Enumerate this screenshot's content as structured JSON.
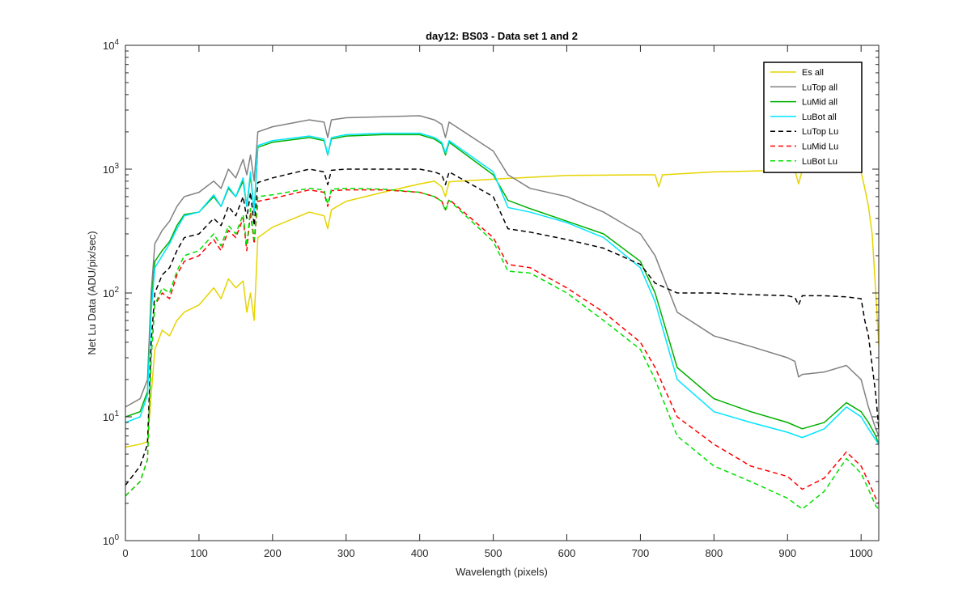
{
  "chart_data": {
    "type": "line",
    "title": "day12: BS03 - Data set 1 and 2",
    "xlabel": "Wavelength (pixels)",
    "ylabel": "Net Lu Data (ADU/pix/sec)",
    "xlim": [
      0,
      1024
    ],
    "ylim": [
      1,
      10000
    ],
    "yscale": "log",
    "x_ticks": [
      0,
      100,
      200,
      300,
      400,
      500,
      600,
      700,
      800,
      900,
      1000
    ],
    "x_tick_labels": [
      "0",
      "100",
      "200",
      "300",
      "400",
      "500",
      "600",
      "700",
      "800",
      "900",
      "1000"
    ],
    "y_ticks": [
      1,
      10,
      100,
      1000,
      10000
    ],
    "y_tick_labels": [
      {
        "base": "10",
        "exp": "0"
      },
      {
        "base": "10",
        "exp": "1"
      },
      {
        "base": "10",
        "exp": "2"
      },
      {
        "base": "10",
        "exp": "3"
      },
      {
        "base": "10",
        "exp": "4"
      }
    ],
    "grid": false,
    "legend_position": "top-right",
    "series": [
      {
        "name": "Es  all",
        "color": "#e6d400",
        "dash": "solid",
        "x": [
          0,
          20,
          30,
          35,
          40,
          50,
          60,
          70,
          80,
          100,
          120,
          130,
          140,
          150,
          160,
          165,
          170,
          175,
          180,
          200,
          250,
          270,
          275,
          280,
          300,
          350,
          400,
          420,
          430,
          435,
          440,
          500,
          600,
          700,
          720,
          725,
          730,
          800,
          900,
          910,
          915,
          920,
          980,
          1000,
          1005,
          1010,
          1015,
          1020,
          1024
        ],
        "y": [
          5.7,
          6,
          6.3,
          15,
          35,
          50,
          45,
          60,
          70,
          80,
          110,
          90,
          130,
          110,
          125,
          70,
          100,
          60,
          280,
          340,
          450,
          420,
          330,
          470,
          550,
          650,
          760,
          800,
          720,
          600,
          790,
          830,
          890,
          900,
          900,
          720,
          900,
          950,
          980,
          980,
          760,
          980,
          980,
          950,
          700,
          500,
          300,
          100,
          38
        ]
      },
      {
        "name": "LuTop  all",
        "color": "#808080",
        "dash": "solid",
        "x": [
          0,
          20,
          30,
          35,
          40,
          50,
          60,
          70,
          80,
          100,
          120,
          130,
          140,
          150,
          160,
          165,
          170,
          175,
          180,
          200,
          250,
          270,
          275,
          280,
          300,
          350,
          400,
          420,
          430,
          435,
          440,
          500,
          520,
          550,
          600,
          650,
          700,
          720,
          750,
          800,
          850,
          900,
          910,
          915,
          920,
          950,
          980,
          1000,
          1010,
          1020,
          1024
        ],
        "y": [
          12,
          14,
          20,
          100,
          250,
          320,
          380,
          500,
          600,
          650,
          800,
          700,
          1000,
          850,
          1200,
          900,
          1300,
          800,
          2000,
          2200,
          2500,
          2400,
          1800,
          2500,
          2600,
          2650,
          2700,
          2500,
          2300,
          1800,
          2400,
          1400,
          900,
          700,
          600,
          450,
          300,
          200,
          70,
          45,
          37,
          30,
          28,
          21,
          22,
          23,
          26,
          20,
          12,
          8,
          7
        ]
      },
      {
        "name": "LuMid  all",
        "color": "#00b000",
        "dash": "solid",
        "x": [
          0,
          20,
          30,
          35,
          40,
          50,
          60,
          70,
          80,
          100,
          120,
          130,
          140,
          150,
          160,
          165,
          170,
          175,
          180,
          200,
          250,
          270,
          275,
          280,
          300,
          350,
          400,
          420,
          430,
          435,
          440,
          500,
          520,
          550,
          600,
          650,
          700,
          720,
          750,
          800,
          850,
          900,
          920,
          950,
          980,
          1000,
          1010,
          1020,
          1024
        ],
        "y": [
          10,
          11,
          16,
          80,
          180,
          220,
          260,
          350,
          430,
          450,
          600,
          500,
          700,
          600,
          800,
          500,
          900,
          450,
          1500,
          1650,
          1800,
          1700,
          1300,
          1750,
          1850,
          1900,
          1900,
          1750,
          1600,
          1300,
          1650,
          900,
          560,
          480,
          380,
          300,
          180,
          100,
          25,
          14,
          11,
          9,
          8,
          9,
          13,
          11,
          9,
          7,
          6
        ]
      },
      {
        "name": "LuBot  all",
        "color": "#00e5ff",
        "dash": "solid",
        "x": [
          0,
          20,
          30,
          35,
          40,
          50,
          60,
          70,
          80,
          100,
          120,
          130,
          140,
          150,
          160,
          165,
          170,
          175,
          180,
          200,
          250,
          270,
          275,
          280,
          300,
          350,
          400,
          420,
          430,
          435,
          440,
          500,
          520,
          550,
          600,
          650,
          700,
          720,
          750,
          800,
          850,
          900,
          920,
          950,
          980,
          1000,
          1010,
          1020,
          1024
        ],
        "y": [
          9,
          10,
          15,
          70,
          160,
          200,
          250,
          330,
          420,
          450,
          620,
          500,
          720,
          600,
          850,
          500,
          950,
          450,
          1550,
          1700,
          1850,
          1750,
          1300,
          1800,
          1900,
          1950,
          1950,
          1800,
          1650,
          1350,
          1700,
          950,
          490,
          450,
          370,
          280,
          160,
          85,
          20,
          11,
          9,
          7.5,
          6.8,
          8,
          12,
          10,
          8,
          6.5,
          6
        ]
      },
      {
        "name": "LuTop  Lu",
        "color": "#000000",
        "dash": "dashed",
        "x": [
          0,
          20,
          30,
          35,
          40,
          50,
          60,
          70,
          80,
          100,
          120,
          130,
          140,
          150,
          160,
          165,
          170,
          175,
          180,
          200,
          250,
          270,
          275,
          280,
          300,
          350,
          400,
          420,
          430,
          435,
          440,
          500,
          520,
          550,
          600,
          650,
          700,
          720,
          750,
          800,
          850,
          900,
          910,
          915,
          920,
          950,
          980,
          1000,
          1005,
          1010,
          1020,
          1024
        ],
        "y": [
          2.8,
          4,
          6,
          40,
          100,
          140,
          160,
          220,
          280,
          300,
          400,
          350,
          500,
          420,
          600,
          400,
          650,
          350,
          780,
          850,
          1000,
          950,
          750,
          980,
          1000,
          1000,
          1000,
          950,
          900,
          750,
          950,
          600,
          330,
          310,
          270,
          230,
          170,
          120,
          100,
          100,
          97,
          95,
          92,
          80,
          95,
          95,
          93,
          90,
          60,
          45,
          15,
          8
        ]
      },
      {
        "name": "LuMid  Lu",
        "color": "#ff0000",
        "dash": "dashed",
        "x": [
          0,
          20,
          30,
          35,
          40,
          50,
          60,
          70,
          80,
          100,
          120,
          130,
          140,
          150,
          160,
          165,
          170,
          175,
          180,
          200,
          250,
          270,
          275,
          280,
          300,
          350,
          400,
          420,
          430,
          435,
          440,
          500,
          520,
          550,
          600,
          650,
          700,
          720,
          750,
          800,
          850,
          900,
          920,
          950,
          980,
          1000,
          1010,
          1020,
          1024
        ],
        "y": [
          2.3,
          3,
          4.5,
          30,
          80,
          100,
          90,
          140,
          180,
          200,
          270,
          220,
          320,
          280,
          400,
          220,
          450,
          250,
          550,
          580,
          680,
          650,
          500,
          670,
          680,
          680,
          650,
          600,
          550,
          470,
          570,
          280,
          170,
          160,
          110,
          70,
          40,
          25,
          10,
          6,
          4,
          3.3,
          2.6,
          3.2,
          5.2,
          4,
          3,
          2.2,
          2
        ]
      },
      {
        "name": "LuBot  Lu",
        "color": "#00e000",
        "dash": "dashed",
        "x": [
          0,
          20,
          30,
          35,
          40,
          50,
          60,
          70,
          80,
          100,
          120,
          130,
          140,
          150,
          160,
          165,
          170,
          175,
          180,
          200,
          250,
          270,
          275,
          280,
          300,
          350,
          400,
          420,
          430,
          435,
          440,
          500,
          520,
          550,
          600,
          650,
          700,
          720,
          750,
          800,
          850,
          900,
          920,
          950,
          980,
          1000,
          1010,
          1020,
          1024
        ],
        "y": [
          2.3,
          3,
          4.5,
          30,
          80,
          110,
          100,
          150,
          200,
          220,
          300,
          240,
          350,
          300,
          430,
          240,
          480,
          270,
          600,
          620,
          700,
          680,
          520,
          690,
          700,
          690,
          650,
          600,
          550,
          460,
          560,
          260,
          150,
          145,
          100,
          60,
          35,
          20,
          7,
          4,
          3,
          2.2,
          1.8,
          2.5,
          4.6,
          3.5,
          2.6,
          1.9,
          1.8
        ]
      }
    ]
  }
}
